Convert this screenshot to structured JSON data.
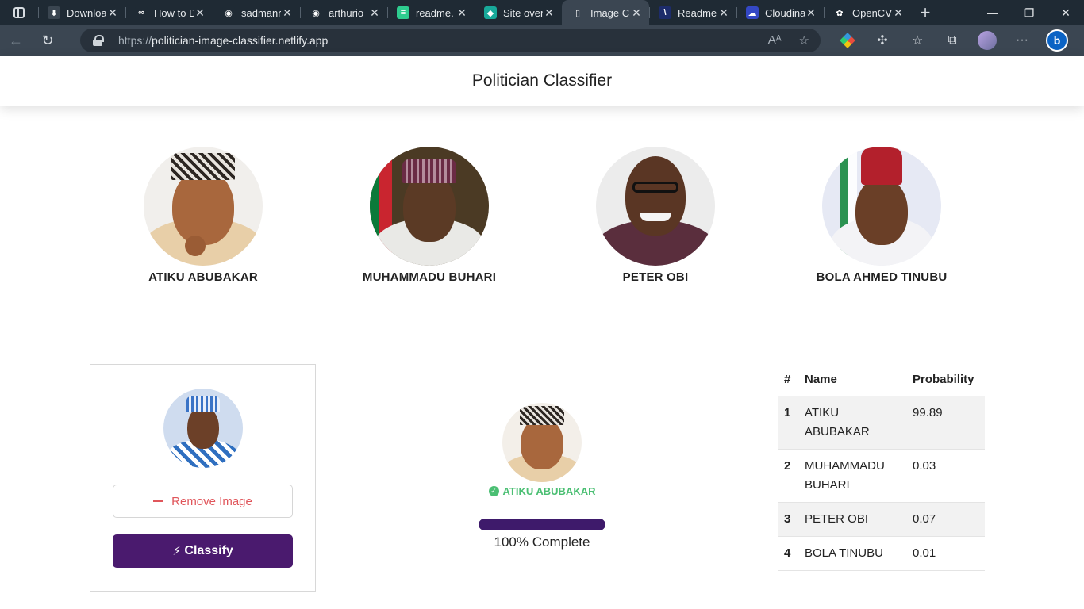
{
  "browser": {
    "tabs": [
      {
        "title": "Downloa",
        "fav_color": "#3a4550",
        "fav_glyph": "⬇"
      },
      {
        "title": "How to D",
        "fav_color": "#1f2a34",
        "fav_glyph": "∞"
      },
      {
        "title": "sadmanr",
        "fav_color": "#1f2a34",
        "fav_glyph": "◉"
      },
      {
        "title": "arthurio",
        "fav_color": "#1f2a34",
        "fav_glyph": "◉"
      },
      {
        "title": "readme.",
        "fav_color": "#2ecc8f",
        "fav_glyph": "≡"
      },
      {
        "title": "Site over",
        "fav_color": "#18a99a",
        "fav_glyph": "◆"
      },
      {
        "title": "Image C",
        "fav_color": "#3b4652",
        "fav_glyph": "▯",
        "active": true
      },
      {
        "title": "Readme",
        "fav_color": "#1d2c6b",
        "fav_glyph": "\\"
      },
      {
        "title": "Cloudina",
        "fav_color": "#3448c5",
        "fav_glyph": "☁"
      },
      {
        "title": "OpenCV",
        "fav_color": "#1f2a34",
        "fav_glyph": "✿"
      }
    ],
    "url_protocol": "https://",
    "url_host": "politician-image-classifier.netlify.app"
  },
  "header": {
    "title": "Politician Classifier"
  },
  "politicians": [
    {
      "name": "ATIKU ABUBAKAR"
    },
    {
      "name": "MUHAMMADU BUHARI"
    },
    {
      "name": "PETER OBI"
    },
    {
      "name": "BOLA AHMED TINUBU"
    }
  ],
  "upload": {
    "remove_label": "Remove Image",
    "classify_label": "Classify"
  },
  "result": {
    "predicted": "ATIKU ABUBAKAR",
    "progress_percent": 100,
    "progress_text": "100% Complete"
  },
  "table": {
    "headers": [
      "#",
      "Name",
      "Probability"
    ],
    "rows": [
      {
        "rank": "1",
        "name": "ATIKU ABUBAKAR",
        "prob": "99.89"
      },
      {
        "rank": "2",
        "name": "MUHAMMADU BUHARI",
        "prob": "0.03"
      },
      {
        "rank": "3",
        "name": "PETER OBI",
        "prob": "0.07"
      },
      {
        "rank": "4",
        "name": "BOLA TINUBU",
        "prob": "0.01"
      }
    ]
  },
  "colors": {
    "accent": "#4a1a6e",
    "success": "#4bbf73",
    "danger": "#e0565b"
  }
}
